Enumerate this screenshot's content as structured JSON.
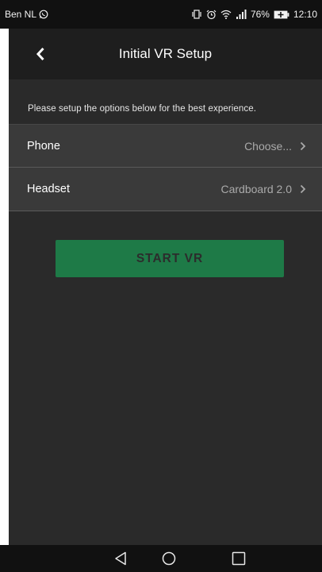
{
  "status_bar": {
    "carrier": "Ben NL",
    "battery": "76%",
    "time": "12:10",
    "icons": [
      "whatsapp-icon",
      "vibrate-icon",
      "alarm-icon",
      "wifi-icon",
      "signal-icon",
      "battery-charging-icon"
    ]
  },
  "app_bar": {
    "title": "Initial VR Setup",
    "back_icon": "chevron-left-icon"
  },
  "content": {
    "instructions": "Please setup the options below for the best experience.",
    "options": [
      {
        "label": "Phone",
        "value": "Choose..."
      },
      {
        "label": "Headset",
        "value": "Cardboard 2.0"
      }
    ],
    "start_label": "START VR"
  },
  "nav_bar": {
    "icons": [
      "back-triangle-icon",
      "home-circle-icon",
      "recents-square-icon"
    ]
  },
  "colors": {
    "status_bar_bg": "#111111",
    "app_bar_bg": "#1e1e1e",
    "content_bg": "#2a2a2a",
    "row_bg": "#3a3a3a",
    "accent_green": "#1e7a47"
  }
}
